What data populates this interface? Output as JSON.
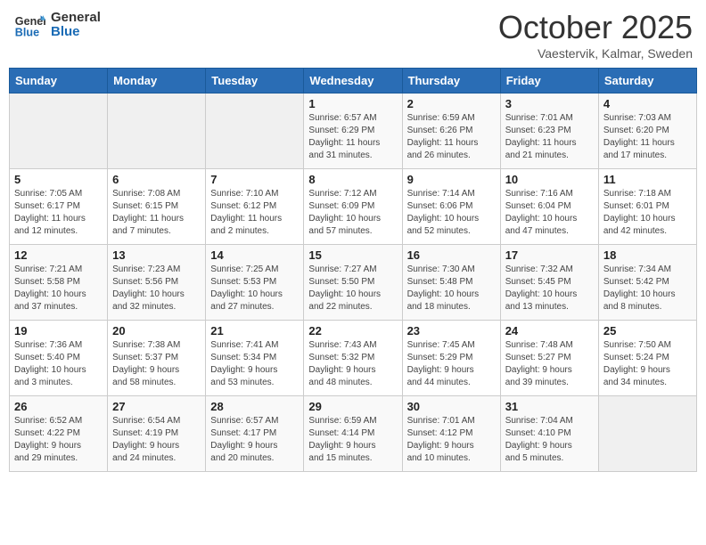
{
  "header": {
    "logo_line1": "General",
    "logo_line2": "Blue",
    "month": "October 2025",
    "location": "Vaestervik, Kalmar, Sweden"
  },
  "days_of_week": [
    "Sunday",
    "Monday",
    "Tuesday",
    "Wednesday",
    "Thursday",
    "Friday",
    "Saturday"
  ],
  "weeks": [
    [
      {
        "day": "",
        "info": ""
      },
      {
        "day": "",
        "info": ""
      },
      {
        "day": "",
        "info": ""
      },
      {
        "day": "1",
        "info": "Sunrise: 6:57 AM\nSunset: 6:29 PM\nDaylight: 11 hours\nand 31 minutes."
      },
      {
        "day": "2",
        "info": "Sunrise: 6:59 AM\nSunset: 6:26 PM\nDaylight: 11 hours\nand 26 minutes."
      },
      {
        "day": "3",
        "info": "Sunrise: 7:01 AM\nSunset: 6:23 PM\nDaylight: 11 hours\nand 21 minutes."
      },
      {
        "day": "4",
        "info": "Sunrise: 7:03 AM\nSunset: 6:20 PM\nDaylight: 11 hours\nand 17 minutes."
      }
    ],
    [
      {
        "day": "5",
        "info": "Sunrise: 7:05 AM\nSunset: 6:17 PM\nDaylight: 11 hours\nand 12 minutes."
      },
      {
        "day": "6",
        "info": "Sunrise: 7:08 AM\nSunset: 6:15 PM\nDaylight: 11 hours\nand 7 minutes."
      },
      {
        "day": "7",
        "info": "Sunrise: 7:10 AM\nSunset: 6:12 PM\nDaylight: 11 hours\nand 2 minutes."
      },
      {
        "day": "8",
        "info": "Sunrise: 7:12 AM\nSunset: 6:09 PM\nDaylight: 10 hours\nand 57 minutes."
      },
      {
        "day": "9",
        "info": "Sunrise: 7:14 AM\nSunset: 6:06 PM\nDaylight: 10 hours\nand 52 minutes."
      },
      {
        "day": "10",
        "info": "Sunrise: 7:16 AM\nSunset: 6:04 PM\nDaylight: 10 hours\nand 47 minutes."
      },
      {
        "day": "11",
        "info": "Sunrise: 7:18 AM\nSunset: 6:01 PM\nDaylight: 10 hours\nand 42 minutes."
      }
    ],
    [
      {
        "day": "12",
        "info": "Sunrise: 7:21 AM\nSunset: 5:58 PM\nDaylight: 10 hours\nand 37 minutes."
      },
      {
        "day": "13",
        "info": "Sunrise: 7:23 AM\nSunset: 5:56 PM\nDaylight: 10 hours\nand 32 minutes."
      },
      {
        "day": "14",
        "info": "Sunrise: 7:25 AM\nSunset: 5:53 PM\nDaylight: 10 hours\nand 27 minutes."
      },
      {
        "day": "15",
        "info": "Sunrise: 7:27 AM\nSunset: 5:50 PM\nDaylight: 10 hours\nand 22 minutes."
      },
      {
        "day": "16",
        "info": "Sunrise: 7:30 AM\nSunset: 5:48 PM\nDaylight: 10 hours\nand 18 minutes."
      },
      {
        "day": "17",
        "info": "Sunrise: 7:32 AM\nSunset: 5:45 PM\nDaylight: 10 hours\nand 13 minutes."
      },
      {
        "day": "18",
        "info": "Sunrise: 7:34 AM\nSunset: 5:42 PM\nDaylight: 10 hours\nand 8 minutes."
      }
    ],
    [
      {
        "day": "19",
        "info": "Sunrise: 7:36 AM\nSunset: 5:40 PM\nDaylight: 10 hours\nand 3 minutes."
      },
      {
        "day": "20",
        "info": "Sunrise: 7:38 AM\nSunset: 5:37 PM\nDaylight: 9 hours\nand 58 minutes."
      },
      {
        "day": "21",
        "info": "Sunrise: 7:41 AM\nSunset: 5:34 PM\nDaylight: 9 hours\nand 53 minutes."
      },
      {
        "day": "22",
        "info": "Sunrise: 7:43 AM\nSunset: 5:32 PM\nDaylight: 9 hours\nand 48 minutes."
      },
      {
        "day": "23",
        "info": "Sunrise: 7:45 AM\nSunset: 5:29 PM\nDaylight: 9 hours\nand 44 minutes."
      },
      {
        "day": "24",
        "info": "Sunrise: 7:48 AM\nSunset: 5:27 PM\nDaylight: 9 hours\nand 39 minutes."
      },
      {
        "day": "25",
        "info": "Sunrise: 7:50 AM\nSunset: 5:24 PM\nDaylight: 9 hours\nand 34 minutes."
      }
    ],
    [
      {
        "day": "26",
        "info": "Sunrise: 6:52 AM\nSunset: 4:22 PM\nDaylight: 9 hours\nand 29 minutes."
      },
      {
        "day": "27",
        "info": "Sunrise: 6:54 AM\nSunset: 4:19 PM\nDaylight: 9 hours\nand 24 minutes."
      },
      {
        "day": "28",
        "info": "Sunrise: 6:57 AM\nSunset: 4:17 PM\nDaylight: 9 hours\nand 20 minutes."
      },
      {
        "day": "29",
        "info": "Sunrise: 6:59 AM\nSunset: 4:14 PM\nDaylight: 9 hours\nand 15 minutes."
      },
      {
        "day": "30",
        "info": "Sunrise: 7:01 AM\nSunset: 4:12 PM\nDaylight: 9 hours\nand 10 minutes."
      },
      {
        "day": "31",
        "info": "Sunrise: 7:04 AM\nSunset: 4:10 PM\nDaylight: 9 hours\nand 5 minutes."
      },
      {
        "day": "",
        "info": ""
      }
    ]
  ]
}
